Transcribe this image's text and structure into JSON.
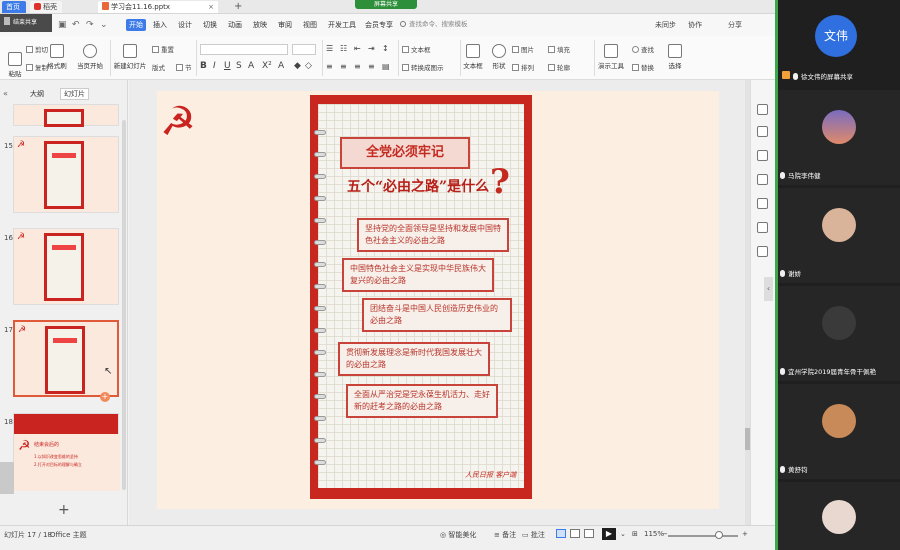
{
  "share_banner": "屏幕共享",
  "mini_share": "结束共享",
  "tabs": {
    "home": "首页",
    "docer": "稻壳",
    "file": "学习会11.16.pptx",
    "add": "+"
  },
  "menu": {
    "items": [
      "开始",
      "插入",
      "设计",
      "切换",
      "动画",
      "放映",
      "审阅",
      "视图",
      "开发工具",
      "会员专享"
    ],
    "active_index": 0,
    "search_placeholder": "查找命令、搜索模板",
    "right": [
      "未同步",
      "协作",
      "分享"
    ]
  },
  "ribbon": {
    "paste": "粘贴",
    "cut": "剪切",
    "copy": "复制",
    "format_painter": "格式刷",
    "from_current": "当页开始",
    "new_slide": "新建幻灯片",
    "layout": "版式",
    "section": "节",
    "reset": "重置",
    "text_box": "文本框",
    "shape": "形状",
    "arrange": "排列",
    "outline": "轮廓",
    "picture": "图片",
    "fill": "填充",
    "convert_smart": "转换成图示",
    "text_box2": "文本框",
    "presentation_tools": "演示工具",
    "replace": "替换",
    "find": "查找",
    "select": "选择",
    "text_effect": "文字效果"
  },
  "left_pane": {
    "tab_outline": "大纲",
    "tab_slides": "幻灯片",
    "slide_numbers": [
      "15",
      "16",
      "17",
      "18"
    ],
    "selected_slide": "17",
    "last_thumb_title": "结束会后的",
    "last_thumb_lines": [
      "1.以知识改变思维的坚持",
      "2.打开对目标的理解与确立"
    ]
  },
  "slide": {
    "banner": "全党必须牢记",
    "headline": "五个“必由之路”是什么",
    "question_mark": "?",
    "points": [
      "坚持党的全面领导是坚持和发展中国特色社会主义的必由之路",
      "中国特色社会主义是实现中华民族伟大复兴的必由之路",
      "团结奋斗是中国人民创造历史伟业的必由之路",
      "贯彻新发展理念是新时代我国发展壮大的必由之路",
      "全面从严治党是党永葆生机活力、走好新的赶考之路的必由之路"
    ],
    "brand": "人民日报 客户端"
  },
  "status": {
    "slide_counter": "幻灯片 17 / 18",
    "theme": "Office 主题",
    "smart_beautify": "智能美化",
    "notes": "备注",
    "comments": "批注",
    "zoom": "115%"
  },
  "zoom_level_percent": 115,
  "meeting": {
    "speaker_name": "文伟",
    "presenter_label": "徐文伟的屏幕共享",
    "participants": [
      "马院李伟健",
      "谢娇",
      "宜州学院2019届青年骨干佩艳",
      "黄舒钧",
      ""
    ]
  },
  "colors": {
    "accent_blue": "#3c7be8",
    "party_red": "#c9241f",
    "meeting_green": "#3aa84a"
  }
}
